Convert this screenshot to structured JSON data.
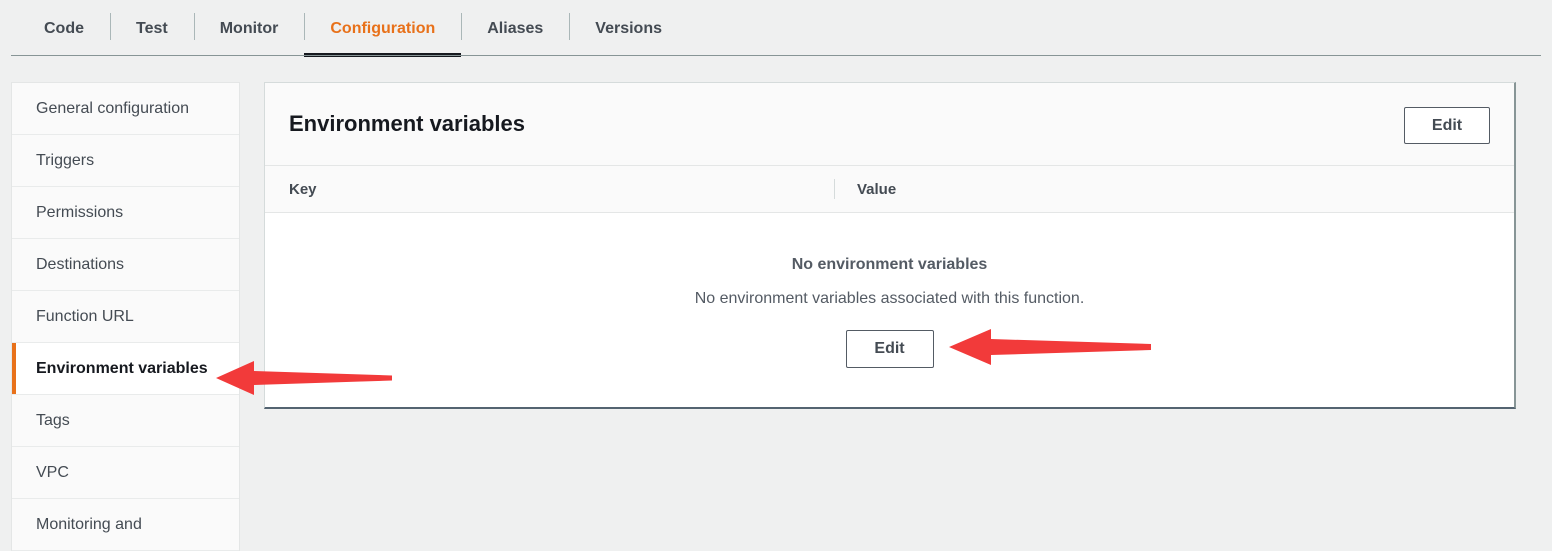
{
  "tabs": [
    {
      "label": "Code",
      "active": false
    },
    {
      "label": "Test",
      "active": false
    },
    {
      "label": "Monitor",
      "active": false
    },
    {
      "label": "Configuration",
      "active": true
    },
    {
      "label": "Aliases",
      "active": false
    },
    {
      "label": "Versions",
      "active": false
    }
  ],
  "sidebar": {
    "items": [
      {
        "label": "General configuration",
        "selected": false
      },
      {
        "label": "Triggers",
        "selected": false
      },
      {
        "label": "Permissions",
        "selected": false
      },
      {
        "label": "Destinations",
        "selected": false
      },
      {
        "label": "Function URL",
        "selected": false
      },
      {
        "label": "Environment variables",
        "selected": true
      },
      {
        "label": "Tags",
        "selected": false
      },
      {
        "label": "VPC",
        "selected": false
      },
      {
        "label": "Monitoring and",
        "selected": false
      }
    ]
  },
  "panel": {
    "title": "Environment variables",
    "edit_top_label": "Edit",
    "table": {
      "columns": [
        "Key",
        "Value"
      ],
      "rows": [],
      "empty_title": "No environment variables",
      "empty_description": "No environment variables associated with this function.",
      "empty_action_label": "Edit"
    }
  },
  "annotations": [
    {
      "name": "arrow-to-sidebar-environment-variables",
      "direction": "left",
      "color": "#f23a3a"
    },
    {
      "name": "arrow-to-edit-button",
      "direction": "left",
      "color": "#f23a3a"
    }
  ],
  "colors": {
    "accent_orange": "#e8711a",
    "page_background": "#eff0f0",
    "panel_background": "#fafafa",
    "annotation_red": "#f23a3a"
  }
}
